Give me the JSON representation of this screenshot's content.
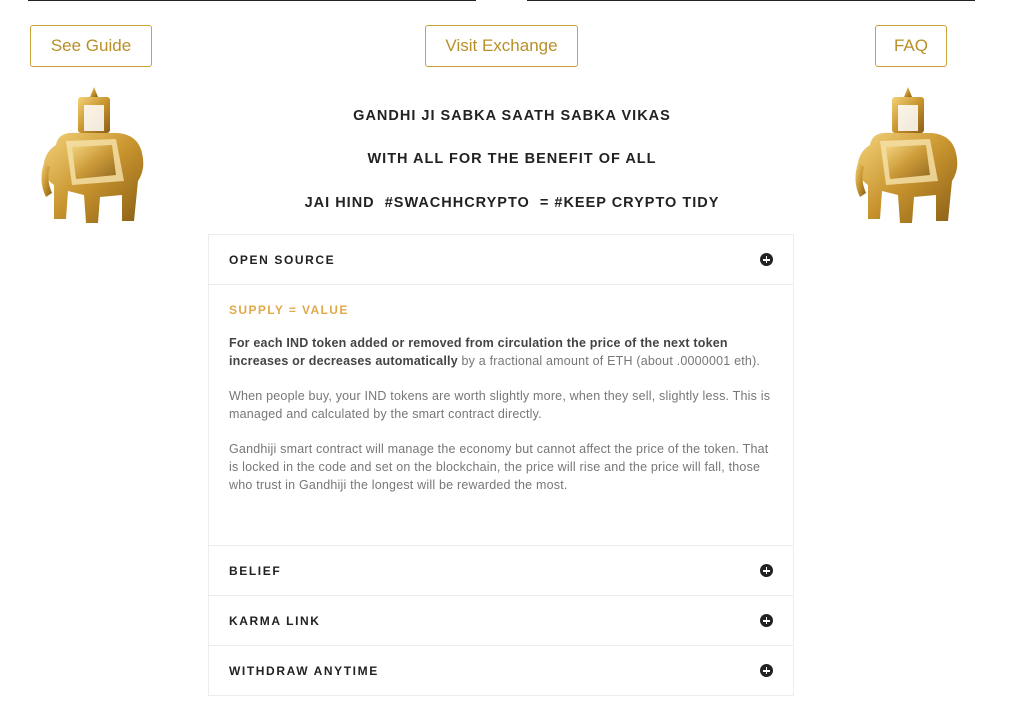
{
  "buttons": {
    "guide": "See Guide",
    "exchange": "Visit Exchange",
    "faq": "FAQ"
  },
  "headlines": [
    "GANDHI JI SABKA SAATH SABKA VIKAS",
    "WITH ALL FOR THE BENEFIT OF ALL",
    "JAI HIND  #SWACHHCRYPTO  = #KEEP CRYPTO TIDY"
  ],
  "accordion": {
    "open_source": "OPEN SOURCE",
    "subtitle": "SUPPLY = VALUE",
    "p1_bold": "For each IND token added or removed from circulation the price of the next token increases or decreases automatically",
    "p1_rest": " by a fractional amount of ETH (about .0000001 eth).",
    "p2": "When people buy, your IND tokens are worth slightly more, when they sell, slightly less. This is managed and calculated by the smart contract directly.",
    "p3": "Gandhiji smart contract will manage the economy but cannot affect the price of the token. That is locked in the code and set on the blockchain, the price will rise and the price will fall, those who trust in Gandhiji the longest will be rewarded the most.",
    "belief": "BELIEF",
    "karma": "KARMA LINK",
    "withdraw": "WITHDRAW ANYTIME"
  },
  "colors": {
    "gold": "#c9a23a",
    "accent": "#e0a94a"
  },
  "icons": [
    "elephant-icon",
    "plus-circle-icon"
  ]
}
